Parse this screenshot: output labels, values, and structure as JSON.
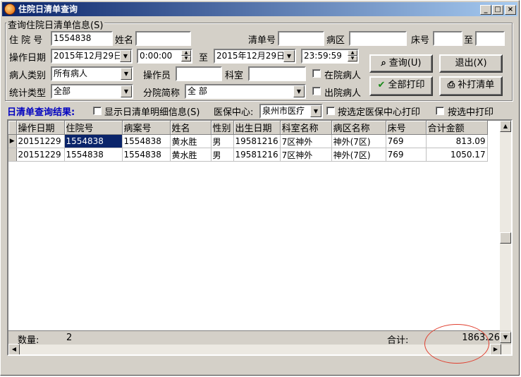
{
  "window": {
    "title": "住院日清单查询",
    "minimize": "_",
    "maximize": "□",
    "close": "×"
  },
  "group": {
    "title": "查询住院日清单信息(S)",
    "admission_no_label": "住 院 号",
    "admission_no_value": "1554838",
    "name_label": "姓名",
    "name_value": "",
    "list_no_label": "清单号",
    "list_no_value": "",
    "ward_label": "病区",
    "ward_value": "",
    "bed_label": "床号",
    "bed_value": "",
    "bed_to_label": "至",
    "bed_to_value": "",
    "op_date_label": "操作日期",
    "date_from": "2015年12月29日",
    "time_from": "0:00:00",
    "to_label": "至",
    "date_to": "2015年12月29日",
    "time_to": "23:59:59",
    "patient_type_label": "病人类别",
    "patient_type_value": "所有病人",
    "operator_label": "操作员",
    "operator_value": "",
    "dept_label": "科室",
    "dept_value": "",
    "in_hospital_label": "在院病人",
    "stat_type_label": "统计类型",
    "stat_type_value": "全部",
    "branch_label": "分院简称",
    "branch_value": "全 部",
    "discharged_label": "出院病人"
  },
  "buttons": {
    "query": "查询(U)",
    "exit": "退出(X)",
    "print_all": "全部打印",
    "reprint": "补打清单"
  },
  "options": {
    "result_title": "日清单查询结果:",
    "show_detail": "显示日清单明细信息(S)",
    "insurance_label": "医保中心:",
    "insurance_value": "泉州市医疗",
    "print_by_center": "按选定医保中心打印",
    "print_selected": "按选中打印"
  },
  "grid": {
    "columns": [
      "操作日期",
      "住院号",
      "病案号",
      "姓名",
      "性别",
      "出生日期",
      "科室名称",
      "病区名称",
      "床号",
      "合计金额"
    ],
    "rows": [
      [
        "20151229",
        "1554838",
        "1554838",
        "黄水胜",
        "男",
        "19581216",
        "7区神外",
        "神外(7区)",
        "769",
        "813.09"
      ],
      [
        "20151229",
        "1554838",
        "1554838",
        "黄水胜",
        "男",
        "19581216",
        "7区神外",
        "神外(7区)",
        "769",
        "1050.17"
      ]
    ],
    "footer": {
      "count_label": "数量:",
      "count_value": "2",
      "total_label": "合计:",
      "total_value": "1863.26"
    }
  },
  "colors": {
    "title_bar": "#0a246a",
    "result_title": "#0000c0",
    "highlight_circle": "#e04030",
    "selection": "#0a246a"
  }
}
